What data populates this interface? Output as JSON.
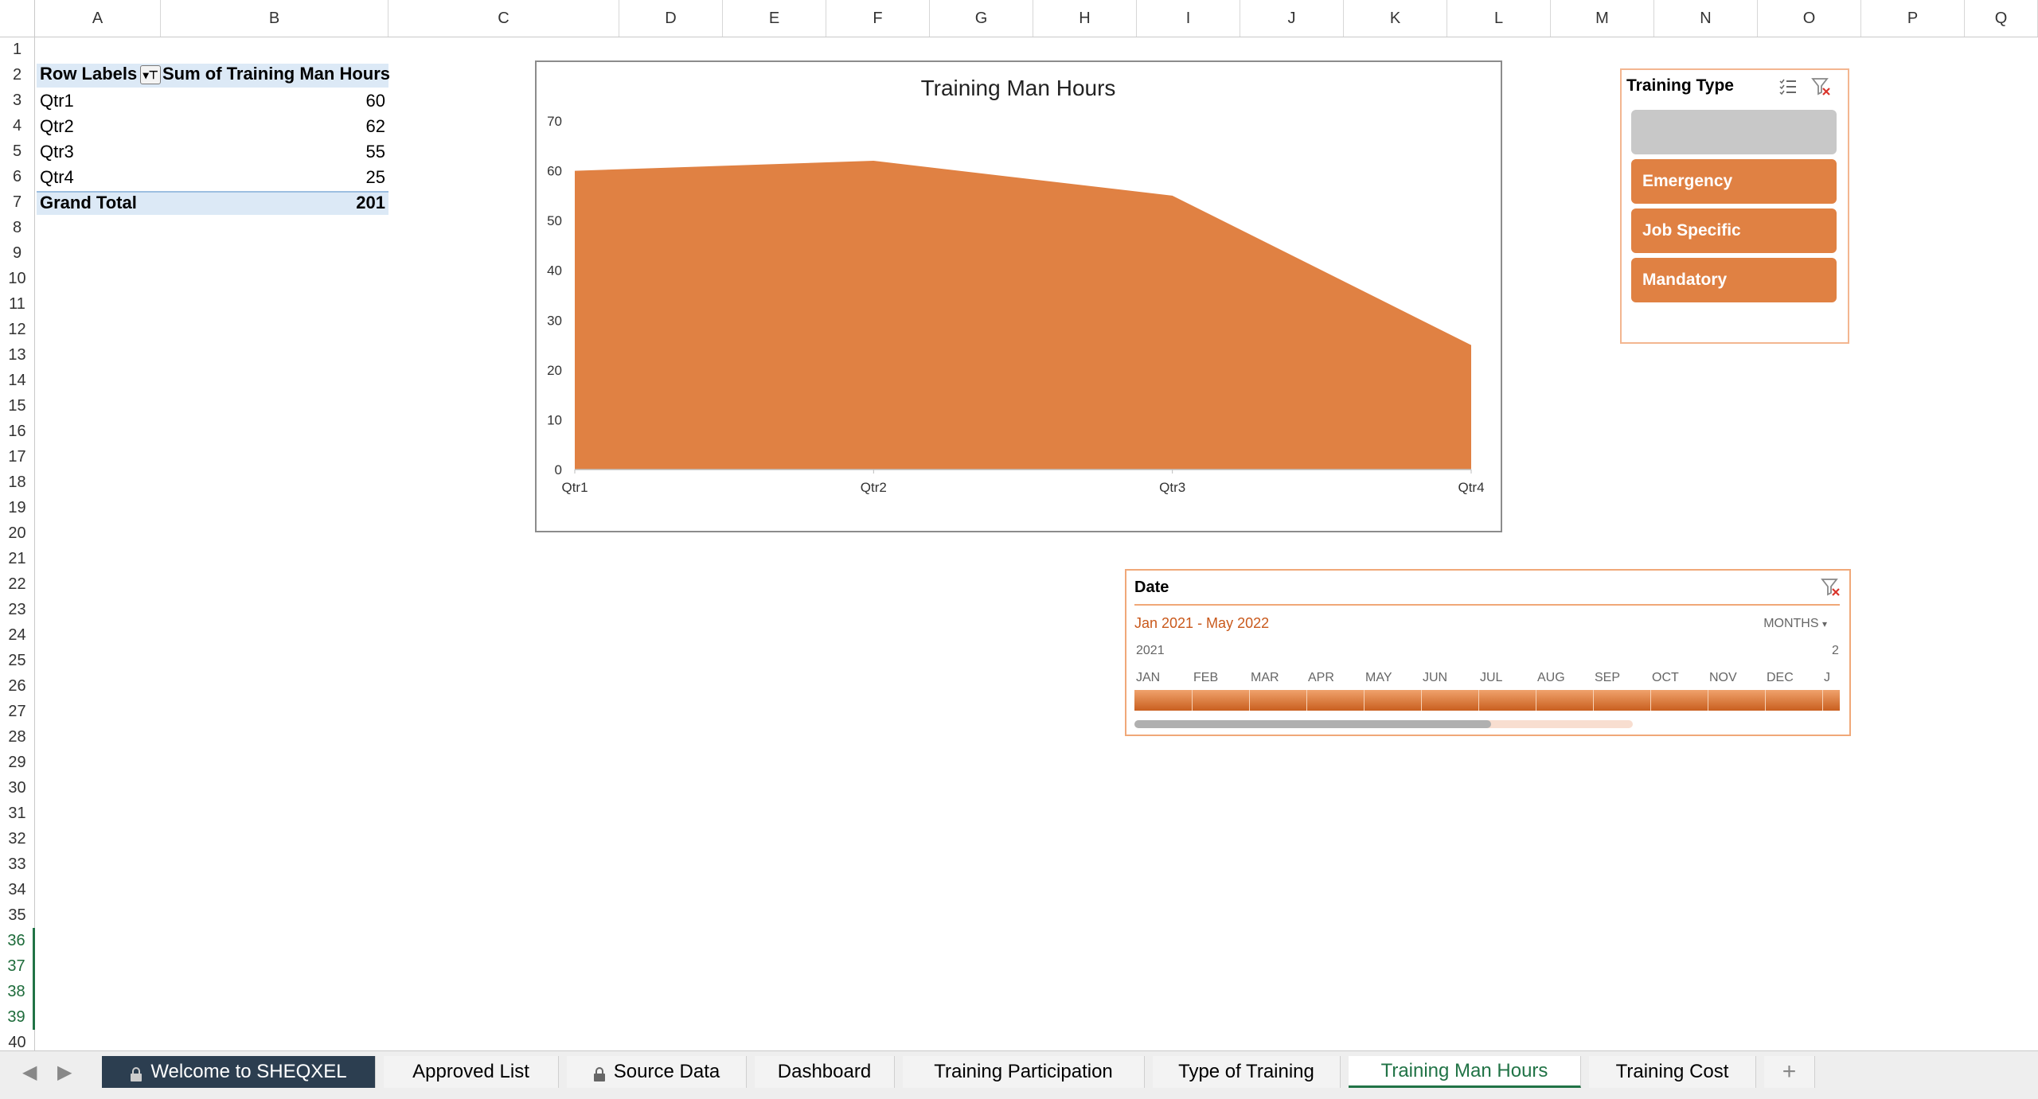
{
  "columns": [
    "A",
    "B",
    "C",
    "D",
    "E",
    "F",
    "G",
    "H",
    "I",
    "J",
    "K",
    "L",
    "M",
    "N",
    "O",
    "P",
    "Q"
  ],
  "rows": [
    "1",
    "2",
    "3",
    "4",
    "5",
    "6",
    "7",
    "8",
    "9",
    "10",
    "11",
    "12",
    "13",
    "14",
    "15",
    "16",
    "17",
    "18",
    "19",
    "20",
    "21",
    "22",
    "23",
    "24",
    "25",
    "26",
    "27",
    "28",
    "29",
    "30",
    "31",
    "32",
    "33",
    "34",
    "35",
    "36",
    "37",
    "38",
    "39",
    "40"
  ],
  "selected_rows": [
    "36",
    "37",
    "38",
    "39"
  ],
  "pivot": {
    "header_label": "Row Labels",
    "header_value": "Sum of Training Man Hours",
    "rows": [
      {
        "label": "Qtr1",
        "value": "60"
      },
      {
        "label": "Qtr2",
        "value": "62"
      },
      {
        "label": "Qtr3",
        "value": "55"
      },
      {
        "label": "Qtr4",
        "value": "25"
      }
    ],
    "total_label": "Grand Total",
    "total_value": "201"
  },
  "chart_data": {
    "type": "area",
    "title": "Training Man Hours",
    "categories": [
      "Qtr1",
      "Qtr2",
      "Qtr3",
      "Qtr4"
    ],
    "values": [
      60,
      62,
      55,
      25
    ],
    "ylim": [
      0,
      70
    ],
    "yticks": [
      "0",
      "10",
      "20",
      "30",
      "40",
      "50",
      "60",
      "70"
    ],
    "color": "#e08143",
    "grid": false
  },
  "slicer": {
    "title": "Training Type",
    "items": [
      "",
      "Emergency",
      "Job Specific",
      "Mandatory"
    ],
    "button_color": "#e08143"
  },
  "timeline": {
    "title": "Date",
    "range": "Jan 2021 - May 2022",
    "level": "MONTHS",
    "year": "2021",
    "next_year_partial": "2",
    "months": [
      "JAN",
      "FEB",
      "MAR",
      "APR",
      "MAY",
      "JUN",
      "JUL",
      "AUG",
      "SEP",
      "OCT",
      "NOV",
      "DEC",
      "J"
    ]
  },
  "tabs": [
    {
      "label": "Welcome to SHEQXEL",
      "locked": true
    },
    {
      "label": "Approved List",
      "locked": false
    },
    {
      "label": "Source Data",
      "locked": true
    },
    {
      "label": "Dashboard",
      "locked": false
    },
    {
      "label": "Training Participation",
      "locked": false
    },
    {
      "label": "Type of Training",
      "locked": false
    },
    {
      "label": "Training Man Hours",
      "locked": false,
      "active": true
    },
    {
      "label": "Training Cost",
      "locked": false
    }
  ],
  "add_sheet_label": "+",
  "active_tab_color": "#217346"
}
